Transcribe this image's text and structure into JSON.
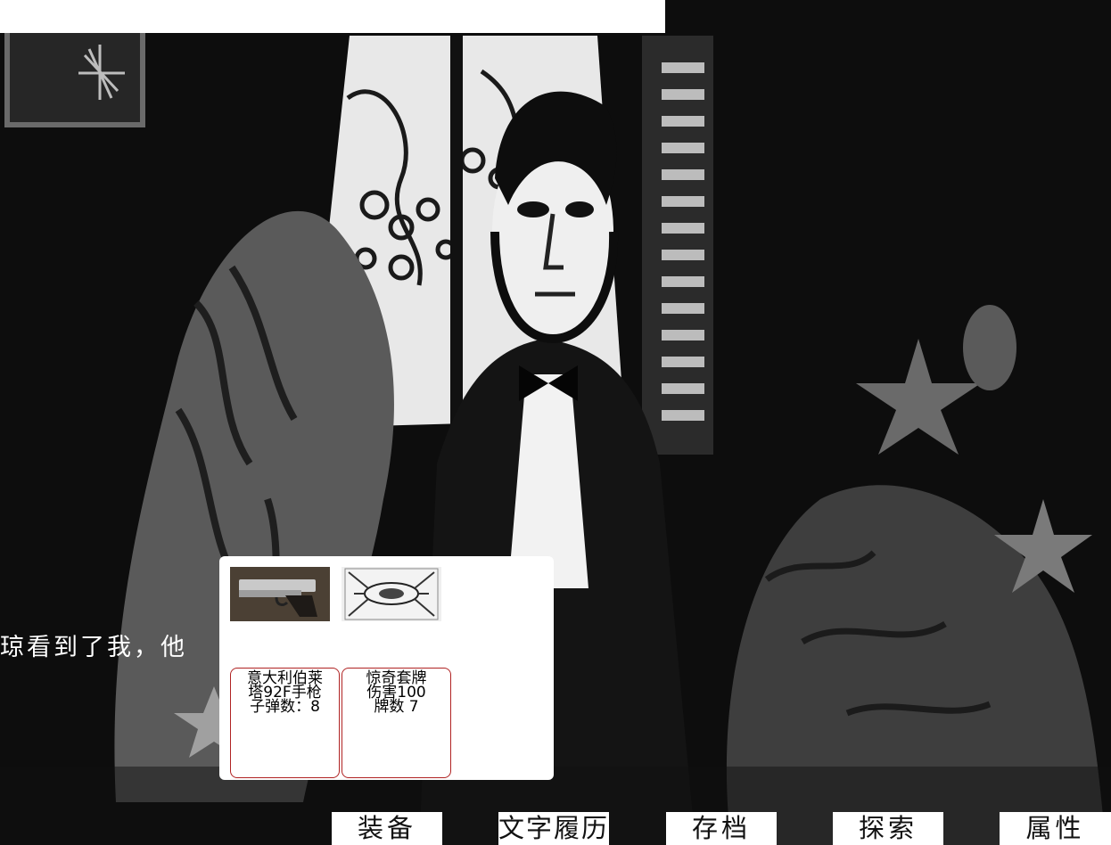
{
  "narration": {
    "text": "琼看到了我，他"
  },
  "inventory": {
    "items": [
      {
        "image": "beretta-92f-pistol",
        "lines": [
          "意大利伯莱",
          "塔92F手枪",
          "子弹数：8"
        ]
      },
      {
        "image": "tarot-card-deck",
        "lines": [
          "惊奇套牌",
          "伤害100",
          "牌数 7"
        ]
      }
    ]
  },
  "menu": {
    "equip": "装备",
    "history": "文字履历",
    "save": "存档",
    "explore": "探索",
    "attributes": "属性"
  },
  "colors": {
    "card_border": "#b02323",
    "background": "#0b0b0b",
    "panel": "#ffffff"
  }
}
